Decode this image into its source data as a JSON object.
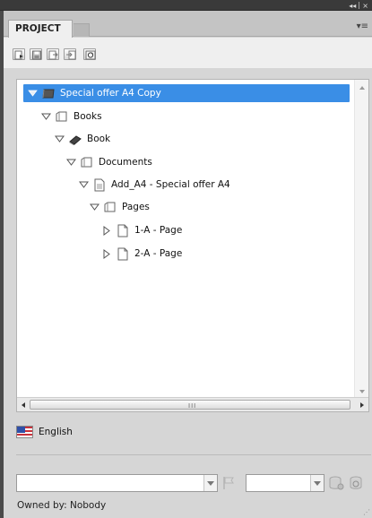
{
  "window": {
    "collapse_glyph": "◂◂",
    "close_glyph": "×"
  },
  "panel": {
    "tab_label": "PROJECT",
    "menu_glyph": "▾≡"
  },
  "toolbar": {
    "buttons": [
      "new-item-icon",
      "save-icon",
      "export-icon",
      "import-icon",
      "refresh-icon"
    ]
  },
  "tree": {
    "items": [
      {
        "label": "Special offer A4 Copy",
        "icon": "project-icon",
        "expanded": true,
        "selected": true
      },
      {
        "label": "Books",
        "icon": "folder-icon",
        "expanded": true
      },
      {
        "label": "Book",
        "icon": "book-icon",
        "expanded": true
      },
      {
        "label": "Documents",
        "icon": "folder-icon",
        "expanded": true
      },
      {
        "label": "Add_A4 - Special offer A4",
        "icon": "document-icon",
        "expanded": true
      },
      {
        "label": "Pages",
        "icon": "folder-icon",
        "expanded": true
      },
      {
        "label": "1-A - Page",
        "icon": "page-icon",
        "expanded": false
      },
      {
        "label": "2-A - Page",
        "icon": "page-icon",
        "expanded": false
      }
    ]
  },
  "scrollbar": {
    "grip": "III"
  },
  "language": {
    "label": "English",
    "flag_icon": "us-flag-icon"
  },
  "filters": {
    "primary_value": "",
    "secondary_value": ""
  },
  "footer": {
    "owner_text": "Owned by: Nobody"
  }
}
